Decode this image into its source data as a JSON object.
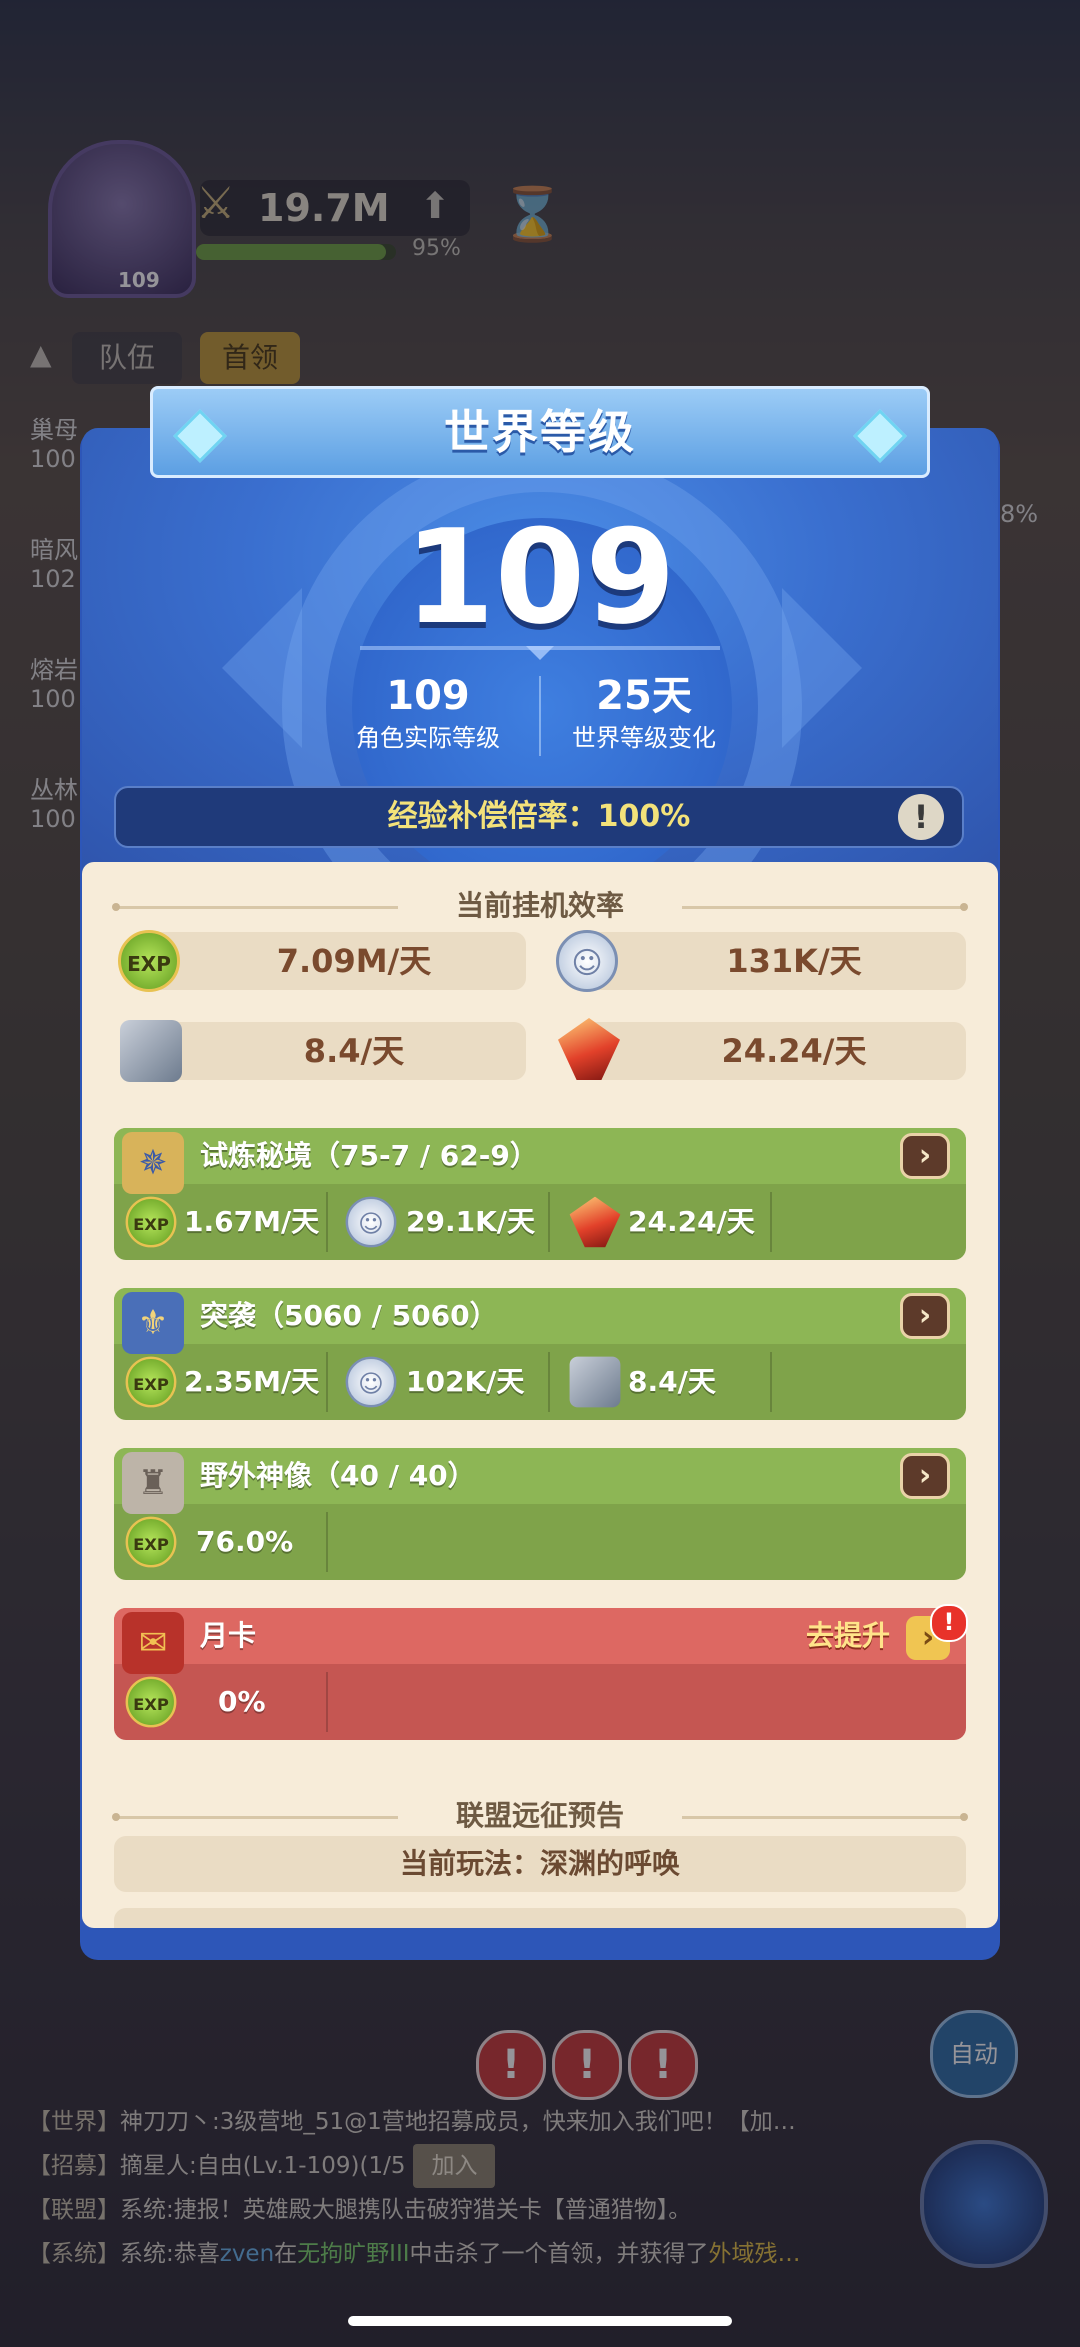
{
  "hud": {
    "level": "109",
    "power": "19.7M",
    "power_progress_pct": 95,
    "power_progress_text": "95%",
    "tabs": [
      "队伍",
      "首领"
    ],
    "side_labels": [
      "巢母",
      "暗风",
      "熔岩",
      "丛林"
    ],
    "side_values": [
      "100",
      "102",
      "100",
      "100"
    ],
    "right_pct": "8%",
    "auto_label": "自动"
  },
  "modal": {
    "title": "世界等级",
    "world_level": "109",
    "actual_level_value": "109",
    "actual_level_label": "角色实际等级",
    "change_value": "25天",
    "change_label": "世界等级变化",
    "exp_compensation": "经验补偿倍率：100%",
    "info_icon": "!"
  },
  "efficiency": {
    "title": "当前挂机效率",
    "rates": [
      {
        "icon": "exp-icon",
        "icon_text": "EXP",
        "value": "7.09M/天"
      },
      {
        "icon": "coin-icon",
        "icon_text": "☺",
        "value": "131K/天"
      },
      {
        "icon": "stone-icon",
        "icon_text": "",
        "value": "8.4/天"
      },
      {
        "icon": "crystal-icon",
        "icon_text": "",
        "value": "24.24/天"
      }
    ]
  },
  "cards": {
    "trial": {
      "title": "试炼秘境（75-7 / 62-9）",
      "icon": "✵",
      "cells": [
        {
          "icon_text": "EXP",
          "value": "1.67M/天"
        },
        {
          "icon_text": "☺",
          "value": "29.1K/天"
        },
        {
          "icon_text": "",
          "value": "24.24/天"
        }
      ]
    },
    "raid": {
      "title": "突袭（5060 / 5060）",
      "icon": "⚜",
      "cells": [
        {
          "icon_text": "EXP",
          "value": "2.35M/天"
        },
        {
          "icon_text": "☺",
          "value": "102K/天"
        },
        {
          "icon_text": "",
          "value": "8.4/天"
        }
      ]
    },
    "statue": {
      "title": "野外神像（40 / 40）",
      "icon": "♜",
      "cells": [
        {
          "icon_text": "EXP",
          "value": "76.0%"
        }
      ]
    },
    "monthly": {
      "title": "月卡",
      "icon": "✉",
      "upgrade_label": "去提升",
      "alert": "!",
      "cells": [
        {
          "icon_text": "EXP",
          "value": "0%"
        }
      ]
    },
    "arrow": "›"
  },
  "alliance": {
    "title": "联盟远征预告",
    "current_mode": "当前玩法：深渊的呼唤"
  },
  "chat": {
    "lines": [
      {
        "channel": "【世界】",
        "name": "神刀刀丶:",
        "text": "3级营地_51@1营地招募成员，快来加入我们吧！【加…"
      },
      {
        "channel": "【招募】",
        "name": "摘星人:",
        "text": "自由(Lv.1-109)(1/5",
        "join": "加入"
      },
      {
        "channel": "【联盟】",
        "name": "系统:",
        "text": "捷报！英雄殿大腿携队击破狩猎关卡【普通猎物】。"
      },
      {
        "channel": "【系统】",
        "name": "系统:",
        "text_a": "恭喜",
        "hl1": "zven",
        "text_b": "在",
        "hl2": "无拘旷野III",
        "text_c": "中击杀了一个首领，并获得了",
        "hl3": "外域残…"
      }
    ]
  }
}
